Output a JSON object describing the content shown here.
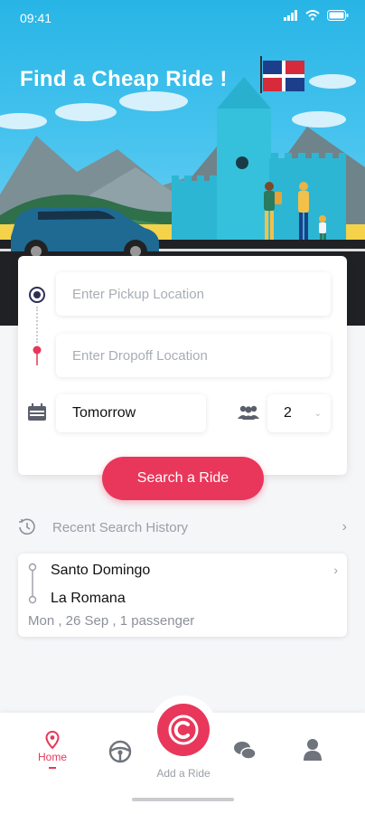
{
  "status_bar": {
    "time": "09:41"
  },
  "hero": {
    "title": "Find a Cheap Ride !"
  },
  "search": {
    "pickup_placeholder": "Enter Pickup Location",
    "dropoff_placeholder": "Enter Dropoff Location",
    "date": "Tomorrow",
    "passengers": "2",
    "button_label": "Search a Ride"
  },
  "history": {
    "title": "Recent Search History",
    "items": [
      {
        "from": "Santo Domingo",
        "to": "La Romana",
        "details": "Mon , 26 Sep , 1 passenger"
      }
    ]
  },
  "bottom_nav": {
    "home_label": "Home",
    "add_label": "Add a Ride"
  },
  "colors": {
    "accent": "#e8375a",
    "sky": "#27b5e6",
    "castle": "#2fb9d6",
    "navy": "#2e2f58"
  },
  "icons": [
    "signal-icon",
    "wifi-icon",
    "battery-icon",
    "pickup-target-icon",
    "dropoff-pin-icon",
    "calendar-icon",
    "people-icon",
    "history-clock-icon",
    "chevron-right-icon",
    "home-pin-icon",
    "steering-wheel-icon",
    "add-ride-icon",
    "chat-icon",
    "user-icon"
  ]
}
